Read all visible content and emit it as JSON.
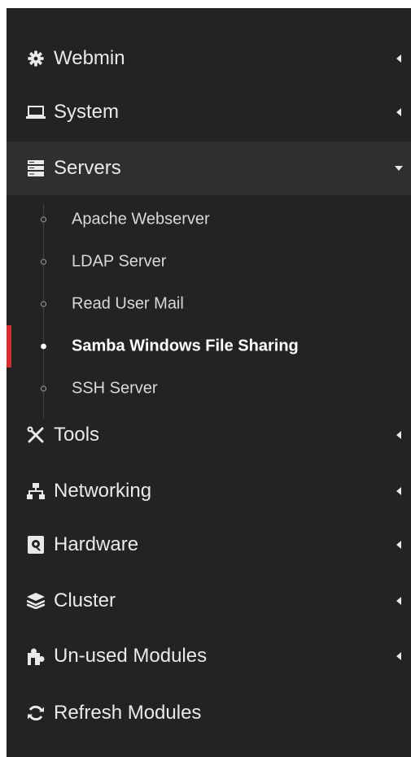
{
  "menu": {
    "webmin": {
      "label": "Webmin",
      "icon": "gear-icon"
    },
    "system": {
      "label": "System",
      "icon": "laptop-icon"
    },
    "servers": {
      "label": "Servers",
      "icon": "server-icon",
      "items": [
        {
          "label": "Apache Webserver"
        },
        {
          "label": "LDAP Server"
        },
        {
          "label": "Read User Mail"
        },
        {
          "label": "Samba Windows File Sharing"
        },
        {
          "label": "SSH Server"
        }
      ]
    },
    "tools": {
      "label": "Tools",
      "icon": "tools-icon"
    },
    "networking": {
      "label": "Networking",
      "icon": "network-icon"
    },
    "hardware": {
      "label": "Hardware",
      "icon": "hardware-icon"
    },
    "cluster": {
      "label": "Cluster",
      "icon": "layers-icon"
    },
    "unused": {
      "label": "Un-used Modules",
      "icon": "puzzle-icon"
    },
    "refresh": {
      "label": "Refresh Modules",
      "icon": "refresh-icon"
    }
  },
  "colors": {
    "sidebar_bg": "#222325",
    "open_bg": "#2d2f31",
    "active_accent": "#d32f2f",
    "text": "#e7e7e7"
  }
}
